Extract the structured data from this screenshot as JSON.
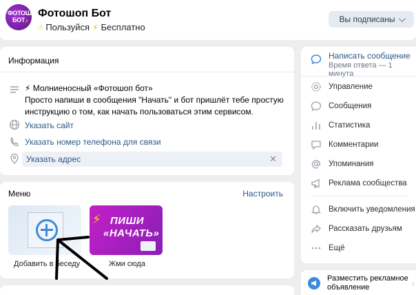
{
  "header": {
    "avatar_text": "ФОТОШОП БОТ",
    "title": "Фотошоп Бот",
    "subtitle_use": "Пользуйся",
    "subtitle_free": "Бесплатно",
    "subscribed_label": "Вы подписаны"
  },
  "info": {
    "title": "Информация",
    "description": "⚡ Молниеносный «Фотошоп бот»\nПросто напиши в сообщения \"Начать\" и бот пришлёт тебе простую инструкцию о том, как начать пользоваться этим сервисом.",
    "site_link": "Указать сайт",
    "phone_link": "Указать номер телефона для связи",
    "address_link": "Указать адрес"
  },
  "menu": {
    "title": "Меню",
    "configure": "Настроить",
    "tiles": [
      {
        "label": "Добавить в беседу"
      },
      {
        "label": "Жми сюда",
        "line1": "ПИШИ",
        "line2": "«НАЧАТЬ»"
      }
    ]
  },
  "sidebar": {
    "write_message": "Написать сообщение",
    "reply_time": "Время ответа — 1 минута",
    "items": [
      {
        "label": "Управление",
        "icon": "gear-icon"
      },
      {
        "label": "Сообщения",
        "icon": "message-icon"
      },
      {
        "label": "Статистика",
        "icon": "stats-icon"
      },
      {
        "label": "Комментарии",
        "icon": "comment-icon"
      },
      {
        "label": "Упоминания",
        "icon": "at-icon"
      },
      {
        "label": "Реклама сообщества",
        "icon": "megaphone-icon"
      },
      {
        "label": "Включить уведомления",
        "icon": "bell-icon"
      },
      {
        "label": "Рассказать друзьям",
        "icon": "share-icon"
      },
      {
        "label": "Ещё",
        "icon": "more-icon"
      }
    ],
    "ad_label": "Разместить рекламное объявление"
  },
  "colors": {
    "link": "#2a5885",
    "accent": "#3d8ad9",
    "brand_purple": "#8a1fb5"
  }
}
